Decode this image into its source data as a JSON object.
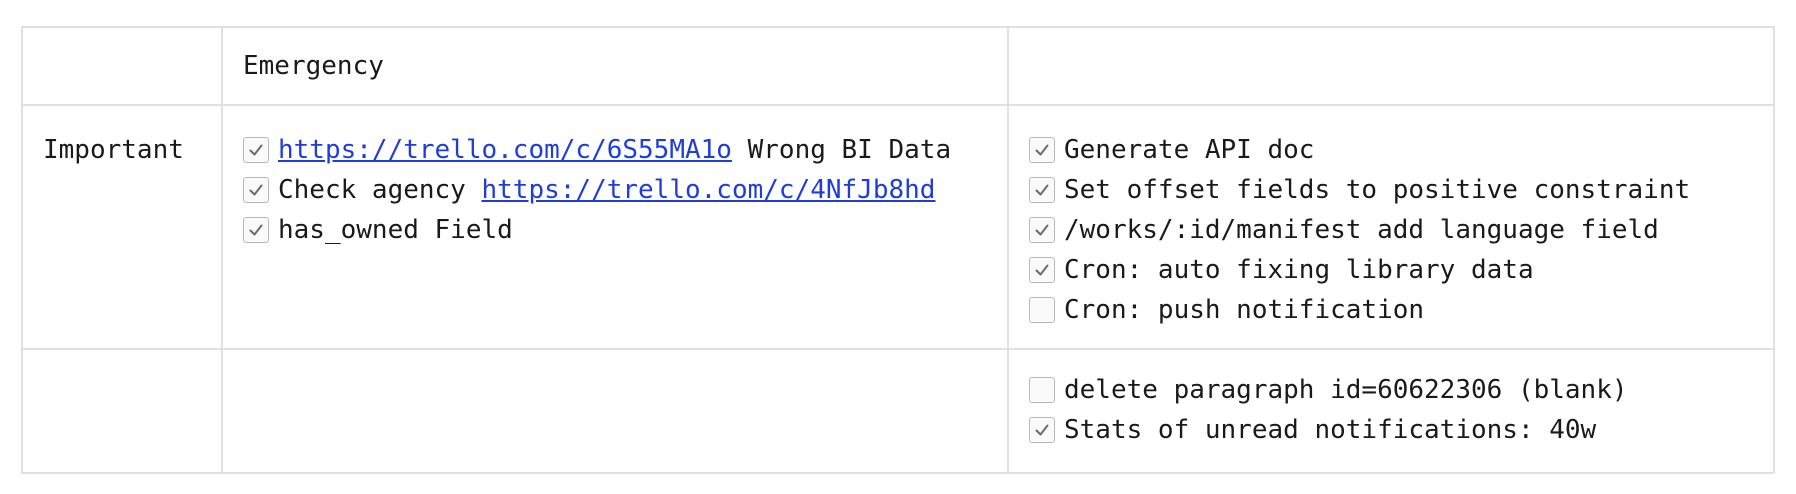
{
  "table": {
    "header": {
      "col_a": "",
      "col_b": "Emergency",
      "col_c": ""
    },
    "rows": [
      {
        "label": "Important",
        "col_b_tasks": [
          {
            "checked": true,
            "prefix": "",
            "link": "https://trello.com/c/6S55MA1o",
            "suffix": " Wrong BI Data"
          },
          {
            "checked": true,
            "prefix": "Check agency ",
            "link": "https://trello.com/c/4NfJb8hd",
            "suffix": ""
          },
          {
            "checked": true,
            "prefix": "has_owned Field",
            "link": "",
            "suffix": ""
          }
        ],
        "col_c_tasks": [
          {
            "checked": true,
            "prefix": "Generate API doc",
            "link": "",
            "suffix": ""
          },
          {
            "checked": true,
            "prefix": "Set offset fields to positive constraint",
            "link": "",
            "suffix": ""
          },
          {
            "checked": true,
            "prefix": "/works/:id/manifest add language field",
            "link": "",
            "suffix": ""
          },
          {
            "checked": true,
            "prefix": "Cron: auto fixing library data",
            "link": "",
            "suffix": ""
          },
          {
            "checked": false,
            "prefix": "Cron: push notification",
            "link": "",
            "suffix": ""
          }
        ]
      },
      {
        "label": "",
        "col_b_tasks": [],
        "col_c_tasks": [
          {
            "checked": false,
            "prefix": "delete paragraph id=60622306 (blank)",
            "link": "",
            "suffix": ""
          },
          {
            "checked": true,
            "prefix": "Stats of unread notifications: 40w",
            "link": "",
            "suffix": ""
          }
        ]
      }
    ]
  },
  "colors": {
    "link": "#1f3dd8",
    "border": "#e0e0e0",
    "checkmark": "#6b6b6b",
    "checkbox_border": "#b8b8b8"
  },
  "icons": {
    "checked": "checkmark-icon"
  }
}
